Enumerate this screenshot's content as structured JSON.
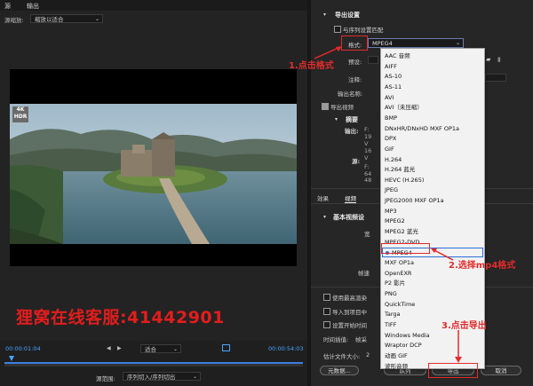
{
  "source_panel": {
    "tabs": [
      "源",
      "输出"
    ],
    "source_scaling_label": "源缩放:",
    "source_scaling_value": "缩放以适合",
    "badge": [
      "4K",
      "HDR"
    ],
    "timecode_start": "00:00:01:04",
    "timecode_end": "00:00:54:03",
    "fit_value": "适合",
    "source_range_label": "源范围:",
    "source_range_value": "序列切入/序列切出",
    "watermark": "狸窝在线客服:41442901"
  },
  "export_settings": {
    "section_title": "导出设置",
    "match_sequence_label": "与序列设置匹配",
    "format_label": "格式:",
    "format_value": "MPEG4",
    "preset_label": "预设:",
    "comments_label": "注释:",
    "output_name_label": "输出名称:",
    "export_video_label": "导出视频",
    "summary_label": "摘要",
    "output_label": "输出:",
    "output_values": [
      "F:",
      "19",
      "V",
      "16",
      "V"
    ],
    "source_label": "源:",
    "source_values": [
      "F:",
      "64",
      "48"
    ],
    "tabs": [
      "效果",
      "视频"
    ],
    "basic_video_label": "基本视频设",
    "width_label": "宽",
    "frame_rate_label": "帧速"
  },
  "bottom_options": {
    "use_max_render": "使用最高渲染",
    "import_project": "导入到项目中",
    "set_start_tc": "设置开始时间",
    "time_interp_label": "时间插值:",
    "time_interp_value": "帧采",
    "est_size_label": "估计文件大小:",
    "est_size_value": "2"
  },
  "buttons": {
    "metadata": "元数据...",
    "queue": "队列",
    "export": "导出",
    "cancel": "取消"
  },
  "format_options": [
    "AAC 音频",
    "AIFF",
    "AS-10",
    "AS-11",
    "AVI",
    "AVI（未压缩）",
    "BMP",
    "DNxHR/DNxHD MXF OP1a",
    "DPX",
    "GIF",
    "H.264",
    "H.264 蓝光",
    "HEVC (H.265)",
    "JPEG",
    "JPEG2000 MXF OP1a",
    "MP3",
    "MPEG2",
    "MPEG2 蓝光",
    "MPEG2-DVD",
    "MPEG4",
    "MXF OP1a",
    "OpenEXR",
    "P2 影片",
    "PNG",
    "QuickTime",
    "Targa",
    "TIFF",
    "Windows Media",
    "Wraptor DCP",
    "动画 GIF",
    "波形音频"
  ],
  "format_selected": "MPEG4",
  "annotations": {
    "step1": "1.点击格式",
    "step2": "2.选择mp4格式",
    "step3": "3.点击导出"
  },
  "colors": {
    "annotation_red": "#e32b2b",
    "timecode_blue": "#4aa3ff",
    "selection_blue": "#2a6fd6"
  }
}
